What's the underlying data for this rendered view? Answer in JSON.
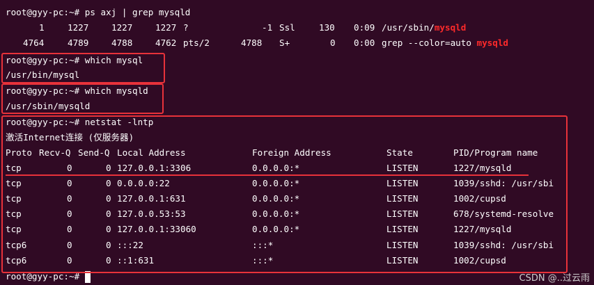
{
  "prompt": "root@gyy-pc:~#",
  "cmd1": "ps axj | grep mysqld",
  "ps_rows": [
    {
      "ppid": "1",
      "pid": "1227",
      "pgid": "1227",
      "sid": "1227",
      "tty": "?",
      "tpgid": "-1",
      "stat": "Ssl",
      "uid": "130",
      "time": "0:09",
      "cmd_pre": "/usr/sbin/",
      "cmd_hl": "mysqld"
    },
    {
      "ppid": "4764",
      "pid": "4789",
      "pgid": "4788",
      "sid": "4762",
      "tty": "pts/2",
      "tpgid": "4788",
      "stat": "S+",
      "uid": "0",
      "time": "0:00",
      "cmd_pre": "grep --color=auto ",
      "cmd_hl": "mysqld"
    }
  ],
  "cmd2": "which mysql",
  "out2": "/usr/bin/mysql",
  "cmd3": "which mysqld",
  "out3": "/usr/sbin/mysqld",
  "cmd4": "netstat -lntp",
  "netstat_title": "激活Internet连接 (仅服务器)",
  "netstat_headers": [
    "Proto",
    "Recv-Q",
    "Send-Q",
    "Local Address",
    "Foreign Address",
    "State",
    "PID/Program name"
  ],
  "netstat_rows": [
    [
      "tcp",
      "0",
      "0",
      "127.0.0.1:3306",
      "0.0.0.0:*",
      "LISTEN",
      "1227/mysqld"
    ],
    [
      "tcp",
      "0",
      "0",
      "0.0.0.0:22",
      "0.0.0.0:*",
      "LISTEN",
      "1039/sshd: /usr/sbi"
    ],
    [
      "tcp",
      "0",
      "0",
      "127.0.0.1:631",
      "0.0.0.0:*",
      "LISTEN",
      "1002/cupsd"
    ],
    [
      "tcp",
      "0",
      "0",
      "127.0.0.53:53",
      "0.0.0.0:*",
      "LISTEN",
      "678/systemd-resolve"
    ],
    [
      "tcp",
      "0",
      "0",
      "127.0.0.1:33060",
      "0.0.0.0:*",
      "LISTEN",
      "1227/mysqld"
    ],
    [
      "tcp6",
      "0",
      "0",
      ":::22",
      ":::*",
      "LISTEN",
      "1039/sshd: /usr/sbi"
    ],
    [
      "tcp6",
      "0",
      "0",
      "::1:631",
      ":::*",
      "LISTEN",
      "1002/cupsd"
    ]
  ],
  "watermark": "CSDN @..过云雨"
}
